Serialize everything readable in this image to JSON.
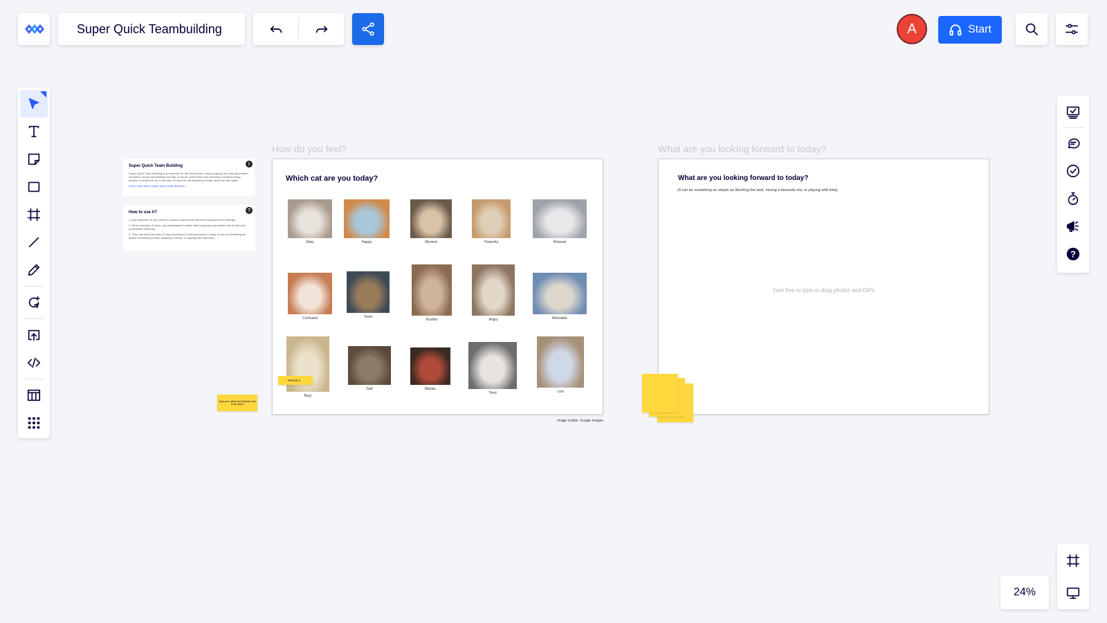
{
  "board": {
    "title": "Super Quick Teambuilding"
  },
  "header": {
    "avatar_initial": "A",
    "start_label": "Start",
    "zoom_level": "24%"
  },
  "info_cards": [
    {
      "title": "Super Quick Team Building",
      "body": "Super Quick Team Building is an exercise for the whole team, which purpose is to talk about team members' moods and feelings this day. It can be used before any planning or brainstorming session to break the ice. It can also be used for retrospectives to talk about the last sprint.",
      "link": "Learn more about Super Quick Team Building →",
      "badge": "i"
    },
    {
      "title": "How to use it?",
      "steps": [
        "1. Ask everyone on your team to choose a cat picture that best expresses their feelings.",
        "2. When everyone is done, ask participants to share with the group and explain why (if they feel comfortable with this).",
        "3. Then ask team members to say what they're looking forward to today (it can be something as simple as finishing a task, watching a movie, or playing with their kids)."
      ],
      "badge": "?"
    }
  ],
  "frame1": {
    "label": "How do you feel?",
    "heading": "Which cat are you today?",
    "credit": "Image credits: Google Images",
    "cats": [
      "Okay",
      "Happy",
      "Worried",
      "Powerful",
      "Relaxed",
      "Confused",
      "Toast",
      "Excited",
      "Angry",
      "Miserable",
      "Busy",
      "Sad",
      "Maniac",
      "Tired",
      "Lost"
    ],
    "person_sticky": "Person 1"
  },
  "frame2": {
    "label": "What are you looking forward to today?",
    "heading": "What are you looking forward to today?",
    "subheading": "(It can be something as simple as finishing the task, having a favourite tea, or playing with kids).",
    "placeholder": "Feel free to type or drag photos and GIFs"
  },
  "side_sticky": {
    "text": "Type your name and drag the card to the photo"
  },
  "colors": {
    "primary": "#1b67ff",
    "share": "#1c6be8",
    "avatar": "#ea4335",
    "sticky": "#ffd83d"
  },
  "icons": {
    "left_toolbar": [
      "select-icon",
      "text-icon",
      "sticky-note-icon",
      "shape-icon",
      "frame-icon",
      "line-icon",
      "pen-icon",
      "comment-icon",
      "upload-icon",
      "embed-icon",
      "templates-icon",
      "apps-icon"
    ],
    "right_toolbar": [
      "card-icon",
      "chat-icon",
      "check-icon",
      "timer-icon",
      "announce-icon",
      "help-icon"
    ]
  }
}
